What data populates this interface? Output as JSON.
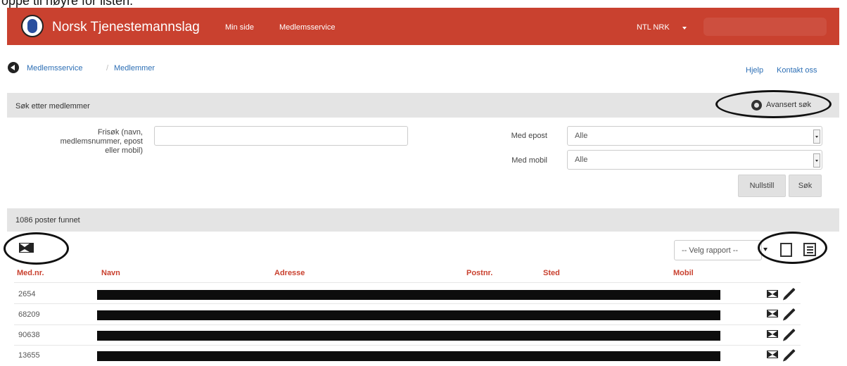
{
  "caption": "oppe til høyre for listen.",
  "navbar": {
    "brand": "Norsk Tjenestemannslag",
    "links": [
      "Min side",
      "Medlemsservice"
    ],
    "user_menu": "NTL NRK",
    "color": "#c9412f"
  },
  "breadcrumb": [
    "Medlemsservice",
    "Medlemmer"
  ],
  "top_links": [
    "Hjelp",
    "Kontakt oss"
  ],
  "search_panel": {
    "title": "Søk etter medlemmer",
    "advanced_label": "Avansert søk",
    "freetext_label_lines": [
      "Frisøk (navn,",
      "medlemsnummer, epost",
      "eller mobil)"
    ],
    "freetext_value": "",
    "email_label": "Med epost",
    "email_value": "Alle",
    "mobile_label": "Med mobil",
    "mobile_value": "Alle",
    "reset_label": "Nullstill",
    "search_label": "Søk"
  },
  "results": {
    "count_text": "1086 poster funnet",
    "report_placeholder": "-- Velg rapport --",
    "headers": [
      "Med.nr.",
      "Navn",
      "Adresse",
      "Postnr.",
      "Sted",
      "Mobil"
    ],
    "rows": [
      {
        "member_number": "2654"
      },
      {
        "member_number": "68209"
      },
      {
        "member_number": "90638"
      },
      {
        "member_number": "13655"
      }
    ]
  },
  "colors": {
    "header_text": "#c9412f",
    "link": "#2d6fb5"
  }
}
